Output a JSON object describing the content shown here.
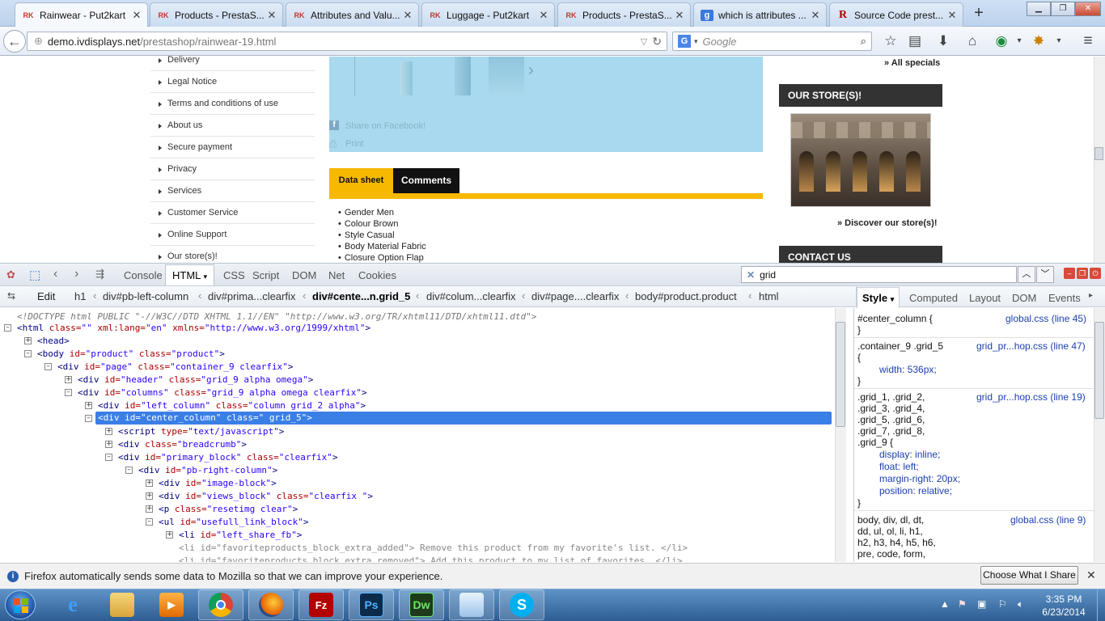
{
  "browser": {
    "tabs": [
      {
        "favicon": "rk-favicon",
        "title": "Rainwear - Put2kart",
        "active": true
      },
      {
        "favicon": "rk-favicon",
        "title": "Products - PrestaS..."
      },
      {
        "favicon": "rk-favicon",
        "title": "Attributes and Valu..."
      },
      {
        "favicon": "rk-favicon",
        "title": "Luggage - Put2kart"
      },
      {
        "favicon": "rk-favicon",
        "title": "Products - PrestaS..."
      },
      {
        "favicon": "google-favicon",
        "title": "which is attributes ..."
      },
      {
        "favicon": "r-favicon",
        "title": "Source Code prest..."
      }
    ],
    "favicon_text": {
      "rk": "RK",
      "g": "g",
      "r": "R"
    },
    "url_host": "demo.ivdisplays.net",
    "url_path": "/prestashop/rainwear-19.html",
    "search_engine": "G",
    "search_placeholder": "Google"
  },
  "page": {
    "left_links": [
      "Delivery",
      "Legal Notice",
      "Terms and conditions of use",
      "About us",
      "Secure payment",
      "Privacy",
      "Services",
      "Customer Service",
      "Online Support",
      "Our store(s)!"
    ],
    "share_facebook": "Share on Facebook!",
    "print": "Print",
    "tab_datasheet": "Data sheet",
    "tab_comments": "Comments",
    "features": [
      "Gender Men",
      "Colour Brown",
      "Style Casual",
      "Body Material Fabric",
      "Closure Option Flap"
    ],
    "all_specials": "» All specials",
    "our_stores_title": "OUR STORE(S)!",
    "discover_stores": "» Discover our store(s)!",
    "contact_us": "CONTACT US"
  },
  "devtools": {
    "toolbar_tabs": [
      "Console",
      "HTML",
      "CSS",
      "Script",
      "DOM",
      "Net",
      "Cookies"
    ],
    "active_tab": "HTML",
    "search_value": "grid",
    "edit_label": "Edit",
    "breadcrumbs": [
      "h1",
      "div#pb-left-column",
      "div#prima...clearfix",
      "div#cente...n.grid_5",
      "div#colum...clearfix",
      "div#page....clearfix",
      "body#product.product",
      "html"
    ],
    "side_tabs": [
      "Style",
      "Computed",
      "Layout",
      "DOM",
      "Events"
    ],
    "html_lines": {
      "doctype": "<!DOCTYPE html PUBLIC \"-//W3C//DTD XHTML 1.1//EN\" \"http://www.w3.org/TR/xhtml11/DTD/xhtml11.dtd\">",
      "l1_a": "<html",
      "l1_an1": " class=",
      "l1_av1": "\"\"",
      "l1_an2": " xml:lang=",
      "l1_av2": "\"en\"",
      "l1_an3": " xmlns=",
      "l1_av3": "\"http://www.w3.org/1999/xhtml\"",
      "l1_e": ">",
      "l2": "<head>",
      "l3_a": "<body",
      "l3_an1": " id=",
      "l3_av1": "\"product\"",
      "l3_an2": " class=",
      "l3_av2": "\"product\"",
      "l3_e": ">",
      "l4_a": "<div",
      "l4_an1": " id=",
      "l4_av1": "\"page\"",
      "l4_an2": " class=",
      "l4_av2": "\"container_9 clearfix\"",
      "l4_e": ">",
      "l5_a": "<div",
      "l5_an1": " id=",
      "l5_av1": "\"header\"",
      "l5_an2": " class=",
      "l5_av2": "\"grid_9 alpha omega\"",
      "l5_e": ">",
      "l6_a": "<div",
      "l6_an1": " id=",
      "l6_av1": "\"columns\"",
      "l6_an2": " class=",
      "l6_av2": "\"grid_9 alpha omega clearfix\"",
      "l6_e": ">",
      "l7_a": "<div",
      "l7_an1": " id=",
      "l7_av1": "\"left_column\"",
      "l7_an2": " class=",
      "l7_av2": "\"column grid_2 alpha\"",
      "l7_e": ">",
      "l8": "<div id=\"center_column\" class=\" grid_5\">",
      "l9_a": "<script",
      "l9_an1": " type=",
      "l9_av1": "\"text/javascript\"",
      "l9_e": ">",
      "l10_a": "<div",
      "l10_an1": " class=",
      "l10_av1": "\"breadcrumb\"",
      "l10_e": ">",
      "l11_a": "<div",
      "l11_an1": " id=",
      "l11_av1": "\"primary_block\"",
      "l11_an2": " class=",
      "l11_av2": "\"clearfix\"",
      "l11_e": ">",
      "l12_a": "<div",
      "l12_an1": " id=",
      "l12_av1": "\"pb-right-column\"",
      "l12_e": ">",
      "l13_a": "<div",
      "l13_an1": " id=",
      "l13_av1": "\"image-block\"",
      "l13_e": ">",
      "l14_a": "<div",
      "l14_an1": " id=",
      "l14_av1": "\"views_block\"",
      "l14_an2": " class=",
      "l14_av2": "\"clearfix \"",
      "l14_e": ">",
      "l15_a": "<p",
      "l15_an1": " class=",
      "l15_av1": "\"resetimg clear\"",
      "l15_e": ">",
      "l16_a": "<ul",
      "l16_an1": " id=",
      "l16_av1": "\"usefull_link_block\"",
      "l16_e": ">",
      "l17_a": "<li",
      "l17_an1": " id=",
      "l17_av1": "\"left_share_fb\"",
      "l17_e": ">",
      "l18": "<li id=\"favoriteproducts_block_extra_added\"> Remove this product from my favorite's list. </li>",
      "l19": "<li id=\"favoriteproducts_block_extra_removed\"> Add this product to my list of favorites. </li>"
    },
    "styles": [
      {
        "selector": "#center_column {",
        "close": "}",
        "source": "global.css (line 45)",
        "props": []
      },
      {
        "selector": ".container_9 .grid_5",
        "open": "{",
        "close": "}",
        "source": "grid_pr...hop.css (line 47)",
        "props": [
          "width: 536px;"
        ]
      },
      {
        "selector_lines": [
          ".grid_1, .grid_2,",
          ".grid_3, .grid_4,",
          ".grid_5, .grid_6,",
          ".grid_7, .grid_8,",
          ".grid_9 {"
        ],
        "close": "}",
        "source": "grid_pr...hop.css (line 19)",
        "props": [
          "display: inline;",
          "float: left;",
          "margin-right: 20px;",
          "position: relative;"
        ]
      },
      {
        "selector_lines": [
          "body, div, dl, dt,",
          "dd, ul, ol, li, h1,",
          "h2, h3, h4, h5, h6,",
          "pre, code, form,"
        ],
        "source": "global.css (line 9)"
      }
    ]
  },
  "notification": {
    "message": "Firefox automatically sends some data to Mozilla so that we can improve your experience.",
    "button": "Choose What I Share"
  },
  "taskbar": {
    "apps": [
      "Internet Explorer",
      "Windows Explorer",
      "Media Player",
      "Chrome",
      "Firefox",
      "FileZilla",
      "Photoshop",
      "Dreamweaver",
      "Notepad",
      "Skype"
    ],
    "app_glyphs": {
      "ps": "Ps",
      "dw": "Dw",
      "fz": "Fz",
      "ie": "e"
    },
    "time": "3:35 PM",
    "date": "6/23/2014"
  }
}
